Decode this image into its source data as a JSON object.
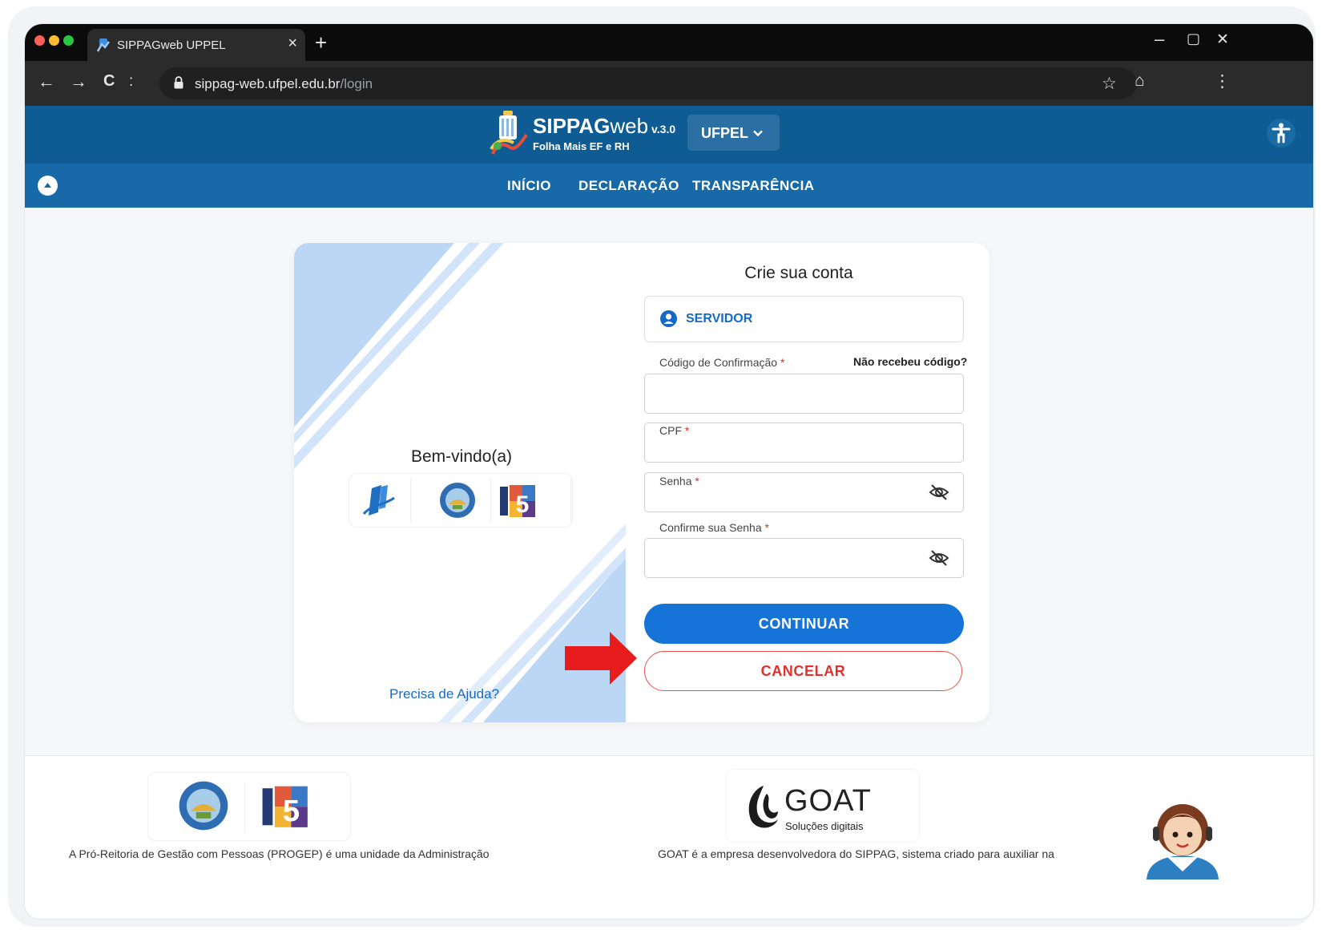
{
  "browser": {
    "tab_title": "SIPPAGweb UPPEL",
    "tab_close": "×",
    "new_tab": "+",
    "url_host": "sippag-web.ufpel.edu.br",
    "url_path": "/login",
    "back": "←",
    "forward": "→",
    "reload": "C",
    "site_info": ":",
    "bookmark": "☆",
    "extensions": "⌂",
    "menu": "⋮",
    "minimize": "–",
    "maximize": "▢",
    "close": "✕"
  },
  "app": {
    "brand_bold": "SIPPAG",
    "brand_light": "web",
    "version": "v.3.0",
    "subtitle": "Folha Mais EF e RH",
    "institution": "UFPEL",
    "nav": [
      "INÍCIO",
      "DECLARAÇÃO",
      "TRANSPARÊNCIA"
    ]
  },
  "login": {
    "welcome": "Bem-vindo(a)",
    "help": "Precisa de Ajuda?",
    "title": "Crie sua conta",
    "user_type": "SERVIDOR",
    "code_label": "Código de Confirmação",
    "resend": "Não recebeu código?",
    "cpf_label": "CPF",
    "password_label": "Senha",
    "confirm_label": "Confirme sua Senha",
    "required_mark": "*",
    "continue": "CONTINUAR",
    "cancel": "CANCELAR"
  },
  "footer": {
    "progep_text": "A Pró-Reitoria de Gestão com Pessoas (PROGEP) é uma unidade da Administração",
    "goat_name": "GOAT",
    "goat_tagline": "Soluções digitais",
    "goat_text": "GOAT é a empresa desenvolvedora do SIPPAG, sistema criado para auxiliar na"
  },
  "colors": {
    "header": "#0f5c94",
    "nav": "#1769a8",
    "primary": "#1673d8",
    "cancel": "#e0322c",
    "arrow": "#e81c1c"
  }
}
